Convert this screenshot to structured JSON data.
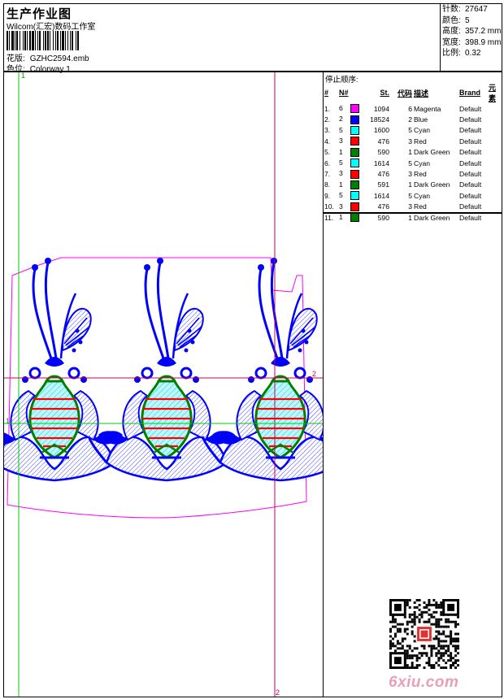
{
  "header": {
    "title": "生产作业图",
    "subtitle": "Wilcom(汇宏)数码工作室",
    "design_label": "花版:",
    "design_value": "GZHC2594.emb",
    "colorway_label": "色位:",
    "colorway_value": "Colorway 1"
  },
  "stats": [
    {
      "label": "针数:",
      "value": "27647"
    },
    {
      "label": "颜色:",
      "value": "5"
    },
    {
      "label": "高度:",
      "value": "357.2 mm"
    },
    {
      "label": "宽度:",
      "value": "398.9 mm"
    },
    {
      "label": "比例:",
      "value": "0.32"
    }
  ],
  "sequence": {
    "title": "停止顺序:",
    "headers": [
      "#",
      "N#",
      "St.",
      "代码",
      "描述",
      "Brand",
      "元素"
    ],
    "rows": [
      {
        "idx": "1.",
        "n": "6",
        "color": "#ff00ff",
        "st": "1094",
        "code": "6",
        "desc": "Magenta",
        "brand": "Default"
      },
      {
        "idx": "2.",
        "n": "2",
        "color": "#0000ff",
        "st": "18524",
        "code": "2",
        "desc": "Blue",
        "brand": "Default"
      },
      {
        "idx": "3.",
        "n": "5",
        "color": "#00ffff",
        "st": "1600",
        "code": "5",
        "desc": "Cyan",
        "brand": "Default"
      },
      {
        "idx": "4.",
        "n": "3",
        "color": "#ff0000",
        "st": "476",
        "code": "3",
        "desc": "Red",
        "brand": "Default"
      },
      {
        "idx": "5.",
        "n": "1",
        "color": "#008000",
        "st": "590",
        "code": "1",
        "desc": "Dark Green",
        "brand": "Default"
      },
      {
        "idx": "6.",
        "n": "5",
        "color": "#00ffff",
        "st": "1614",
        "code": "5",
        "desc": "Cyan",
        "brand": "Default"
      },
      {
        "idx": "7.",
        "n": "3",
        "color": "#ff0000",
        "st": "476",
        "code": "3",
        "desc": "Red",
        "brand": "Default"
      },
      {
        "idx": "8.",
        "n": "1",
        "color": "#008000",
        "st": "591",
        "code": "1",
        "desc": "Dark Green",
        "brand": "Default"
      },
      {
        "idx": "9.",
        "n": "5",
        "color": "#00ffff",
        "st": "1614",
        "code": "5",
        "desc": "Cyan",
        "brand": "Default"
      },
      {
        "idx": "10.",
        "n": "3",
        "color": "#ff0000",
        "st": "476",
        "code": "3",
        "desc": "Red",
        "brand": "Default"
      },
      {
        "idx": "11.",
        "n": "1",
        "color": "#008000",
        "st": "590",
        "code": "1",
        "desc": "Dark Green",
        "brand": "Default"
      }
    ]
  },
  "guides": {
    "v1": "1",
    "v2": "2",
    "h1": "1",
    "h2": "2"
  },
  "watermark": "6xiu.com",
  "colors": {
    "guide_green": "#00cc00",
    "guide_red": "#cc0055",
    "outline_magenta": "#ff00ff",
    "stitch_blue": "#0000ff"
  }
}
